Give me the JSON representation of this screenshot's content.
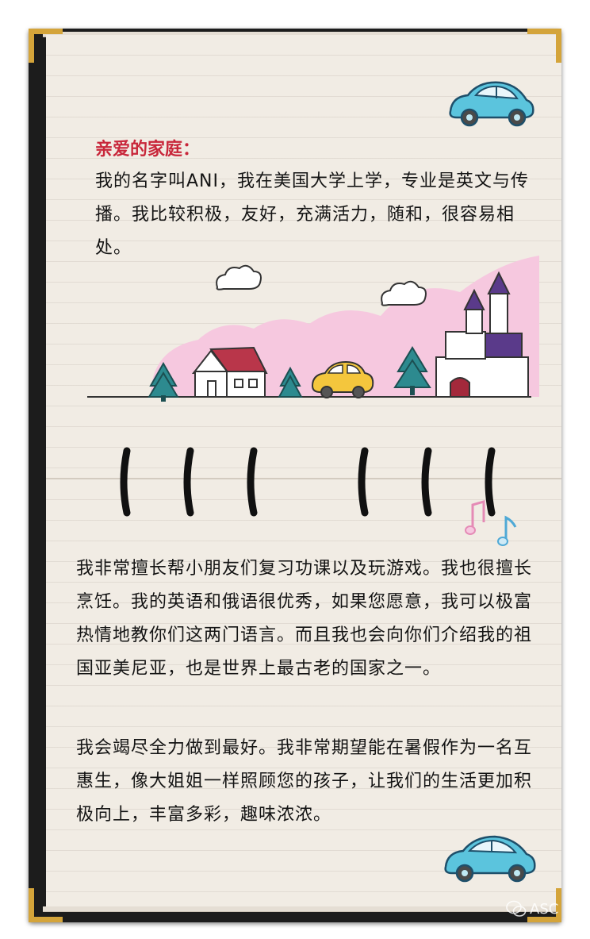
{
  "letter": {
    "greeting": "亲爱的家庭：",
    "intro": "我的名字叫ANI，我在美国大学上学，专业是英文与传播。我比较积极，友好，充满活力，随和，很容易相处。",
    "skills": "我非常擅长帮小朋友们复习功课以及玩游戏。我也很擅长烹饪。我的英语和俄语很优秀，如果您愿意，我可以极富热情地教你们这两门语言。而且我也会向你们介绍我的祖国亚美尼亚，也是世界上最古老的国家之一。",
    "closing": "我会竭尽全力做到最好。我非常期望能在暑假作为一名互惠生，像大姐姐一样照顾您的孩子，让我们的生活更加积极向上，丰富多彩，趣味浓浓。"
  },
  "watermark": {
    "text": "ASC",
    "icon": "wechat-icon"
  },
  "colors": {
    "greeting": "#c8263a",
    "text": "#141414",
    "paper": "#f1ece4",
    "cover": "#1c1c1c",
    "corner_gold": "#d4a43a",
    "hill_pink": "#f6c8df",
    "tree_teal": "#2d8a8f",
    "car_blue": "#5bc4dd",
    "car_yellow": "#f4c63d"
  },
  "icons": [
    "car-icon",
    "cloud-icon",
    "house-icon",
    "castle-icon",
    "tree-icon",
    "music-note-icon",
    "spiral-ring-icon",
    "wechat-icon"
  ]
}
